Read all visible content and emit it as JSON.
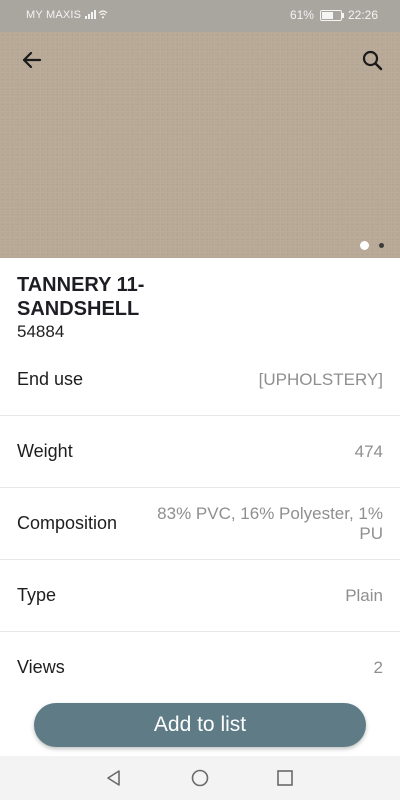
{
  "status_bar": {
    "carrier": "MY MAXIS",
    "battery": "61%",
    "battery_level": 0.61,
    "time": "22:26"
  },
  "product": {
    "name": "TANNERY 11-SANDSHELL",
    "code": "54884",
    "image_count": 2,
    "current_image": 1
  },
  "specs": [
    {
      "label": "End use",
      "value": "[UPHOLSTERY]"
    },
    {
      "label": "Weight",
      "value": "474"
    },
    {
      "label": "Composition",
      "value": "83% PVC, 16% Polyester, 1% PU"
    },
    {
      "label": "Type",
      "value": "Plain"
    },
    {
      "label": "Views",
      "value": "2"
    }
  ],
  "actions": {
    "add_to_list": "Add to list"
  },
  "icons": {
    "back": "back-arrow-icon",
    "search": "search-icon",
    "nav_back": "triangle-back-icon",
    "nav_home": "circle-home-icon",
    "nav_recents": "square-recents-icon"
  },
  "colors": {
    "hero_swatch": "#b7a996",
    "accent": "#5e7b86"
  }
}
